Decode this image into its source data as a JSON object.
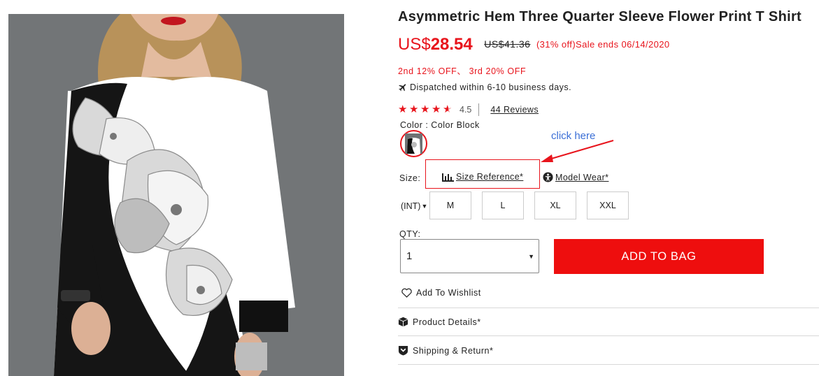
{
  "product": {
    "title": "Asymmetric Hem Three Quarter Sleeve Flower Print T Shirt",
    "price_currency": "US$",
    "price_value": "28.54",
    "old_price": "US$41.36",
    "discount_text": "(31% off)Sale ends 06/14/2020",
    "promo": "2nd 12% OFF、 3rd 20% OFF",
    "dispatch": "Dispatched within 6-10 business days.",
    "rating": "4.5",
    "rating_stars": 4.5,
    "reviews_link": "44 Reviews",
    "color_label": "Color : Color Block"
  },
  "annotation": {
    "click_here": "click here"
  },
  "size": {
    "label": "Size:",
    "size_reference": "Size Reference*",
    "model_wear": "Model Wear*",
    "system": "(INT)",
    "options": [
      "M",
      "L",
      "XL",
      "XXL"
    ]
  },
  "qty": {
    "label": "QTY:",
    "value": "1"
  },
  "actions": {
    "add_to_bag": "ADD TO BAG",
    "wishlist": "Add To Wishlist"
  },
  "sections": {
    "product_details": "Product Details*",
    "shipping_return": "Shipping & Return*"
  },
  "colors": {
    "accent_red": "#e8141c",
    "button_red": "#ee0e0e",
    "annotation_blue": "#3b6fd6"
  }
}
